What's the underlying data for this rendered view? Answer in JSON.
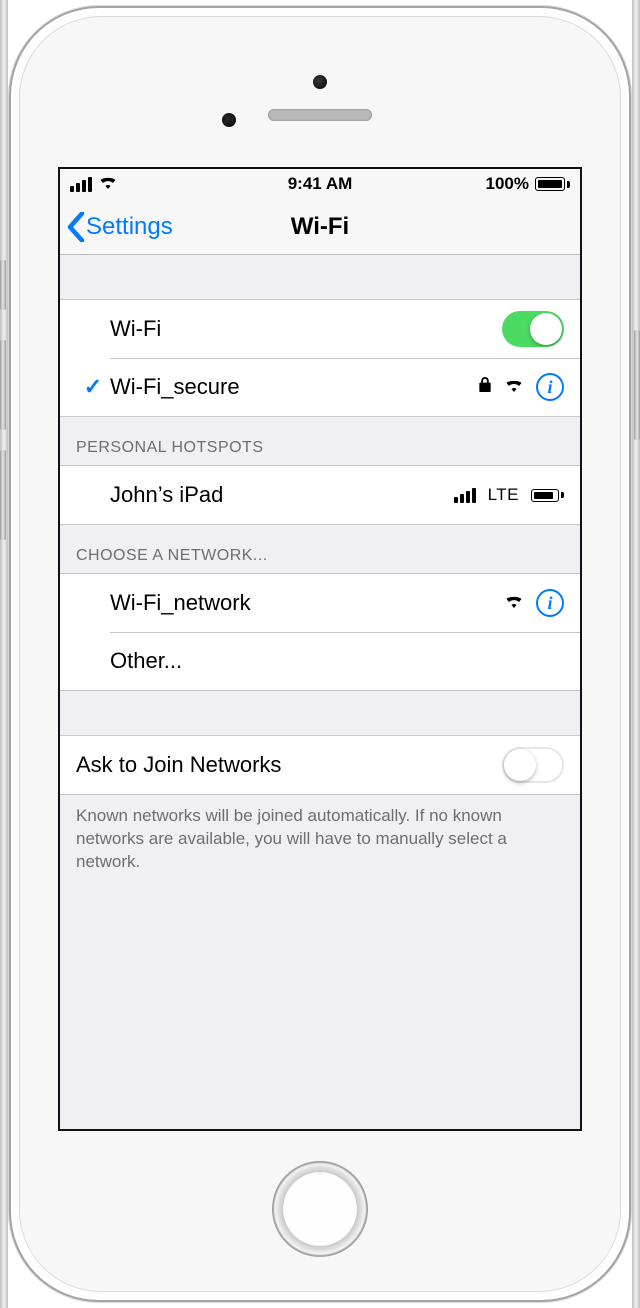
{
  "status": {
    "time": "9:41 AM",
    "battery_pct": "100%"
  },
  "nav": {
    "back_label": "Settings",
    "title": "Wi-Fi"
  },
  "wifi_toggle": {
    "label": "Wi-Fi",
    "on": true
  },
  "connected": {
    "ssid": "Wi-Fi_secure",
    "secured": true
  },
  "personal_hotspots": {
    "header": "Personal Hotspots",
    "items": [
      {
        "name": "John’s iPad",
        "network_type": "LTE"
      }
    ]
  },
  "choose_network": {
    "header": "Choose a Network...",
    "items": [
      {
        "ssid": "Wi-Fi_network",
        "secured": false
      }
    ],
    "other_label": "Other..."
  },
  "ask_to_join": {
    "label": "Ask to Join Networks",
    "on": false,
    "footer": "Known networks will be joined automatically. If no known networks are available, you will have to manually select a network."
  }
}
